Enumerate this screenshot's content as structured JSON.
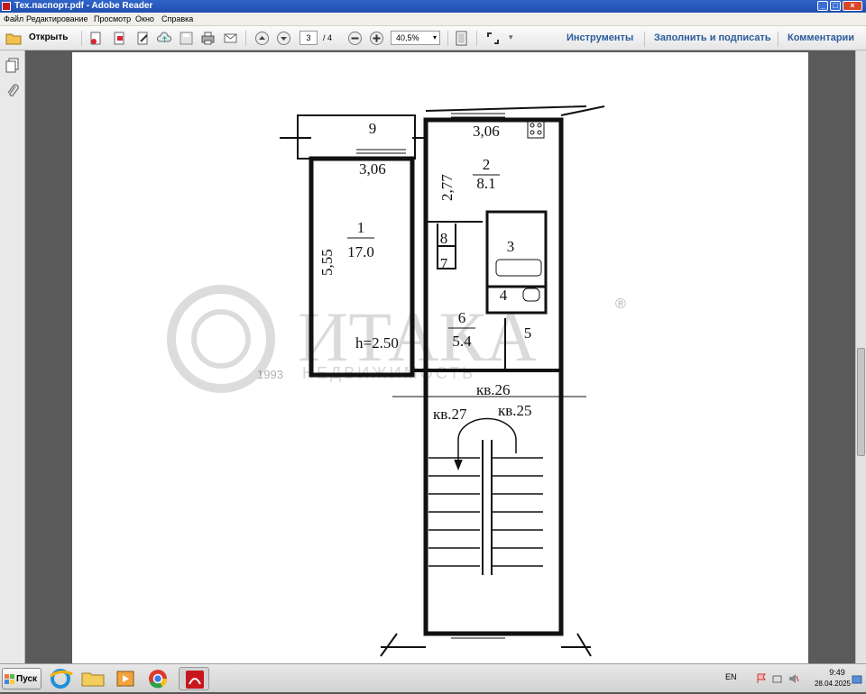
{
  "window": {
    "title": "Тех.паспорт.pdf - Adobe Reader",
    "controls": [
      "minimize",
      "maximize",
      "close"
    ]
  },
  "menu": [
    "Файл",
    "Редактирование",
    "Просмотр",
    "Окно",
    "Справка"
  ],
  "toolbar": {
    "open_label": "Открыть",
    "page_current": "3",
    "page_total": "/ 4",
    "zoom": "40,5%",
    "tools_label": "Инструменты",
    "fill_sign_label": "Заполнить и подписать",
    "comments_label": "Комментарии"
  },
  "floorplan": {
    "rooms": [
      {
        "num": "1",
        "area": "17.0"
      },
      {
        "num": "2",
        "area": "8.1"
      },
      {
        "num": "3"
      },
      {
        "num": "4"
      },
      {
        "num": "5"
      },
      {
        "num": "6",
        "area": "5.4"
      },
      {
        "num": "7"
      },
      {
        "num": "8"
      },
      {
        "num": "9"
      }
    ],
    "dimensions": [
      "3,06",
      "3,06",
      "3,06",
      "5,55",
      "2,77"
    ],
    "height": "h=2.50",
    "apartments": [
      "кв.26",
      "кв.27",
      "кв.25"
    ],
    "watermark": {
      "text": "ИТАКА",
      "sub": "НЕДВИЖИМОСТЬ",
      "year": "1993",
      "reg": "®"
    }
  },
  "taskbar": {
    "start_label": "Пуск",
    "apps": [
      "internet-explorer",
      "file-explorer",
      "media-player",
      "chrome",
      "adobe-reader"
    ],
    "lang": "EN",
    "time": "9:49",
    "date": "28.04.2025"
  }
}
